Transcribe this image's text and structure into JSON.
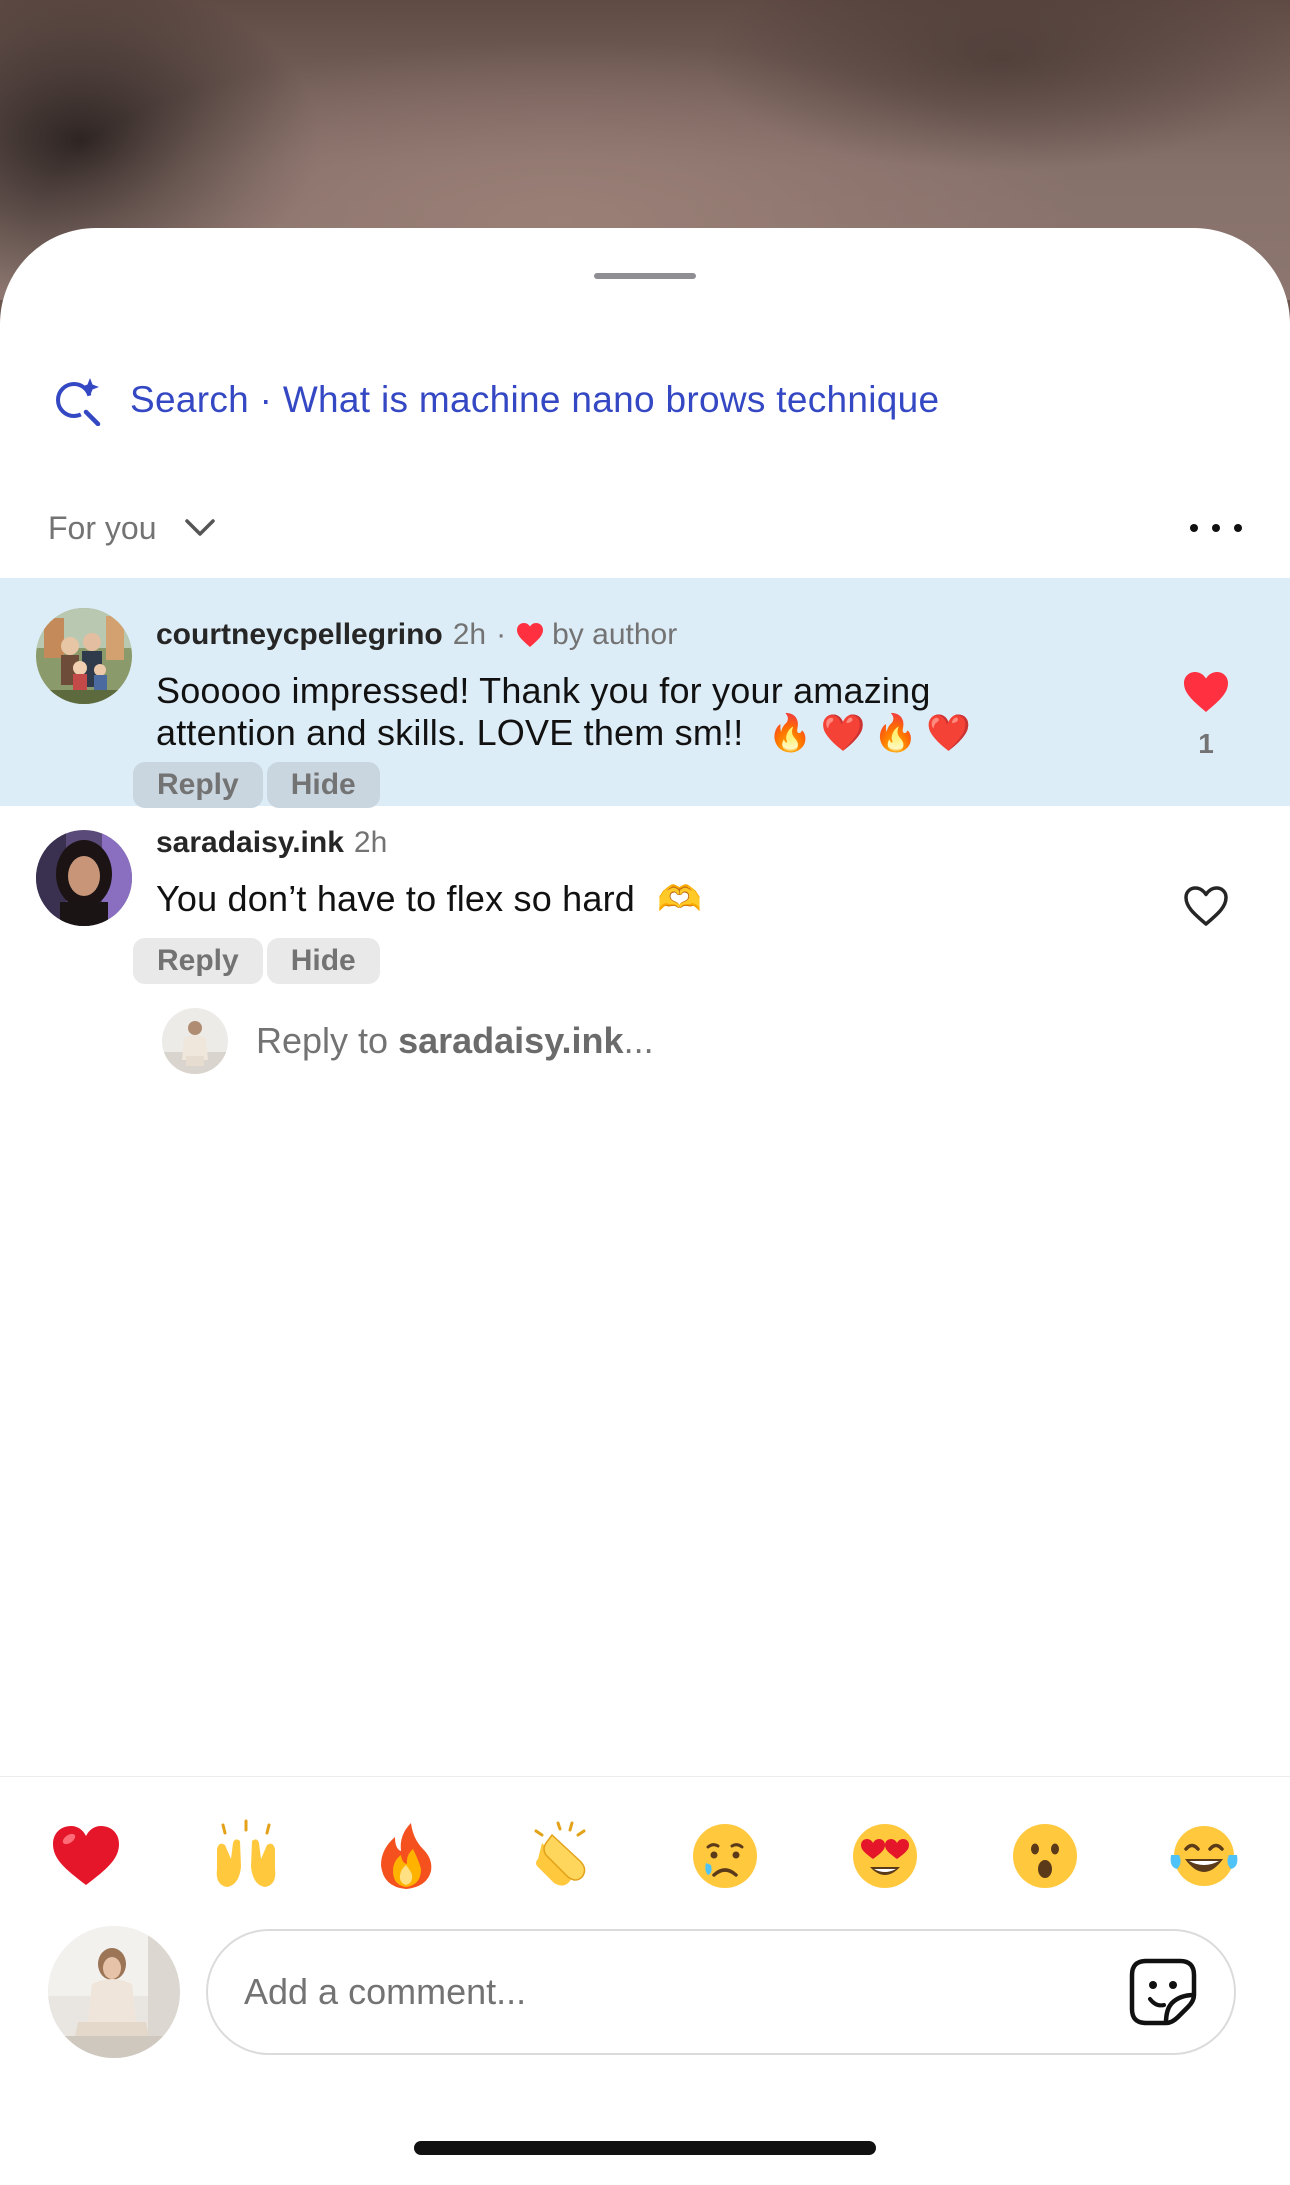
{
  "search": {
    "label": "Search · What is machine nano brows technique"
  },
  "sort": {
    "label": "For you"
  },
  "comments": [
    {
      "username": "courtneycpellegrino",
      "time": "2h",
      "separator": "·",
      "by_author": "by author",
      "text_line1": "Sooooo impressed! Thank you for your amazing",
      "text_line2": "attention and skills. LOVE them sm!!",
      "text_emojis": "🔥❤️🔥❤️",
      "reply_label": "Reply",
      "hide_label": "Hide",
      "like_count": "1",
      "liked": true
    },
    {
      "username": "saradaisy.ink",
      "time": "2h",
      "text": "You don’t have to flex so hard",
      "text_emoji": "🫶",
      "reply_label": "Reply",
      "hide_label": "Hide",
      "liked": false
    }
  ],
  "reply_prompt": {
    "prefix": "Reply to ",
    "username": "saradaisy.ink",
    "suffix": "..."
  },
  "quick_reactions": [
    "❤️",
    "🙌",
    "🔥",
    "👏",
    "😢",
    "😍",
    "😮",
    "😂"
  ],
  "composer": {
    "placeholder": "Add a comment..."
  },
  "colors": {
    "accent_link": "#3548c4",
    "like_red": "#ff3040",
    "highlight_bg": "#ddedf7",
    "muted_text": "#737373"
  }
}
